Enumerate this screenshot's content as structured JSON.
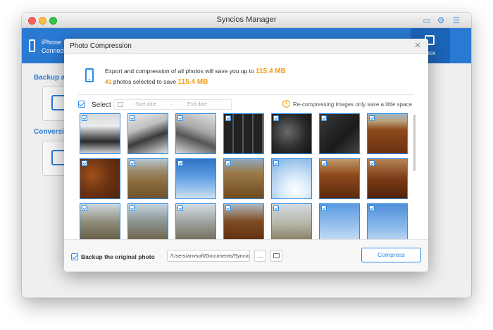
{
  "app": {
    "title": "Syncios Manager",
    "device_label": "iPhone Connect",
    "nav_active_label": "lbox",
    "sections": [
      "Backup an",
      "Conversion"
    ]
  },
  "dialog": {
    "title": "Photo Compression",
    "info": {
      "line1_prefix": "Export and compression of all photos will save you up to",
      "total_savings": "115.4 MB",
      "selected_count": "41",
      "line2_mid": "photos selected to save",
      "selected_savings": "115.4 MB"
    },
    "select_label": "Select",
    "date_start_placeholder": "Start date",
    "date_separator": "-",
    "date_end_placeholder": "End date",
    "warning": "Re-compressing images only save a little space",
    "photos": [
      "img-desk1",
      "img-desk2",
      "img-desk3",
      "img-keys1",
      "img-keys2",
      "img-keys3",
      "img-forest1",
      "img-forest2",
      "img-river1",
      "img-sky1",
      "img-aerial1",
      "img-sky2",
      "img-forest3",
      "img-forest4",
      "img-land1",
      "img-land2",
      "img-land3",
      "img-forest5",
      "img-land4",
      "img-sky3",
      "img-sky4"
    ]
  },
  "footer": {
    "backup_label": "Backup the original photo",
    "path": "/Users/anvsoft/Documents/Syncios",
    "more_button": "...",
    "compress_button": "Compress"
  },
  "colors": {
    "accent": "#2a8ce8",
    "highlight": "#f39c12",
    "nav_bar": "#2a7ad4"
  }
}
